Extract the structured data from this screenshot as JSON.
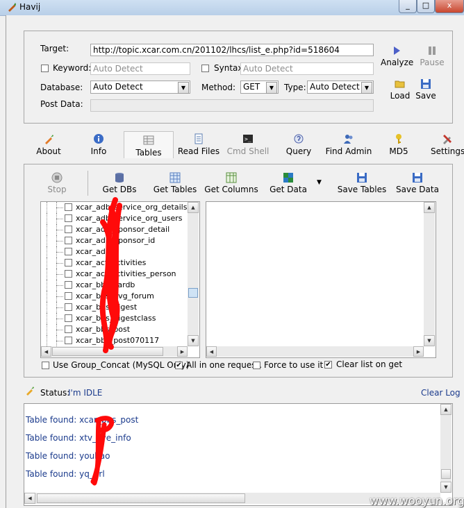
{
  "window": {
    "title": "Havij",
    "controls": [
      "_",
      "□",
      "x"
    ]
  },
  "target_section": {
    "target_label": "Target:",
    "target_value": "http://topic.xcar.com.cn/201102/lhcs/list_e.php?id=518604",
    "keyword_label": "Keyword:",
    "keyword_value": "Auto Detect",
    "syntax_label": "Syntax:",
    "syntax_value": "Auto Detect",
    "database_label": "Database:",
    "database_value": "Auto Detect",
    "method_label": "Method:",
    "method_value": "GET",
    "type_label": "Type:",
    "type_value": "Auto Detect",
    "postdata_label": "Post Data:",
    "postdata_value": ""
  },
  "actions": {
    "analyze": "Analyze",
    "pause": "Pause",
    "load": "Load",
    "save": "Save"
  },
  "tabs": [
    {
      "label": "About",
      "icon": "carrot-icon"
    },
    {
      "label": "Info",
      "icon": "info-icon"
    },
    {
      "label": "Tables",
      "icon": "table-icon"
    },
    {
      "label": "Read Files",
      "icon": "document-icon"
    },
    {
      "label": "Cmd Shell",
      "icon": "console-icon"
    },
    {
      "label": "Query",
      "icon": "query-icon"
    },
    {
      "label": "Find Admin",
      "icon": "users-icon"
    },
    {
      "label": "MD5",
      "icon": "key-icon"
    },
    {
      "label": "Settings",
      "icon": "tools-icon"
    }
  ],
  "toolbar": {
    "stop": "Stop",
    "get_dbs": "Get DBs",
    "get_tables": "Get Tables",
    "get_columns": "Get Columns",
    "get_data": "Get Data",
    "save_tables": "Save Tables",
    "save_data": "Save Data"
  },
  "tree_items": [
    "xcar_adb_service_org_details",
    "xcar_adb_service_org_users",
    "xcar_adb_sponsor_detail",
    "xcar_adb_sponsor_id",
    "xcar_ad",
    "xcar_act_activities",
    "xcar_act_activities_person",
    "xcar_bbs_cardb",
    "xcar_bbs_avg_forum",
    "xcar_bbs_digest",
    "xcar_bbs_digestclass",
    "xcar_bbs_post",
    "xcar_bbs_post070117"
  ],
  "options": {
    "group_concat": "Use Group_Concat (MySQL Only)",
    "all_in_one": "All in one request.",
    "force_use": "Force to use it",
    "clear_list": "Clear list on get"
  },
  "status": {
    "label": "Status:",
    "value": "I'm IDLE",
    "clear_log": "Clear Log"
  },
  "log_lines": [
    "Table found: xcar_bbs_post",
    "Table found: xtv_live_info",
    "Table found: youbao",
    "Table found: yq_url"
  ],
  "watermark": "www.wooyun.org",
  "colors": {
    "status_value": "#1a3a8c",
    "link": "#1a3a8c",
    "redaction": "#ff0000"
  }
}
